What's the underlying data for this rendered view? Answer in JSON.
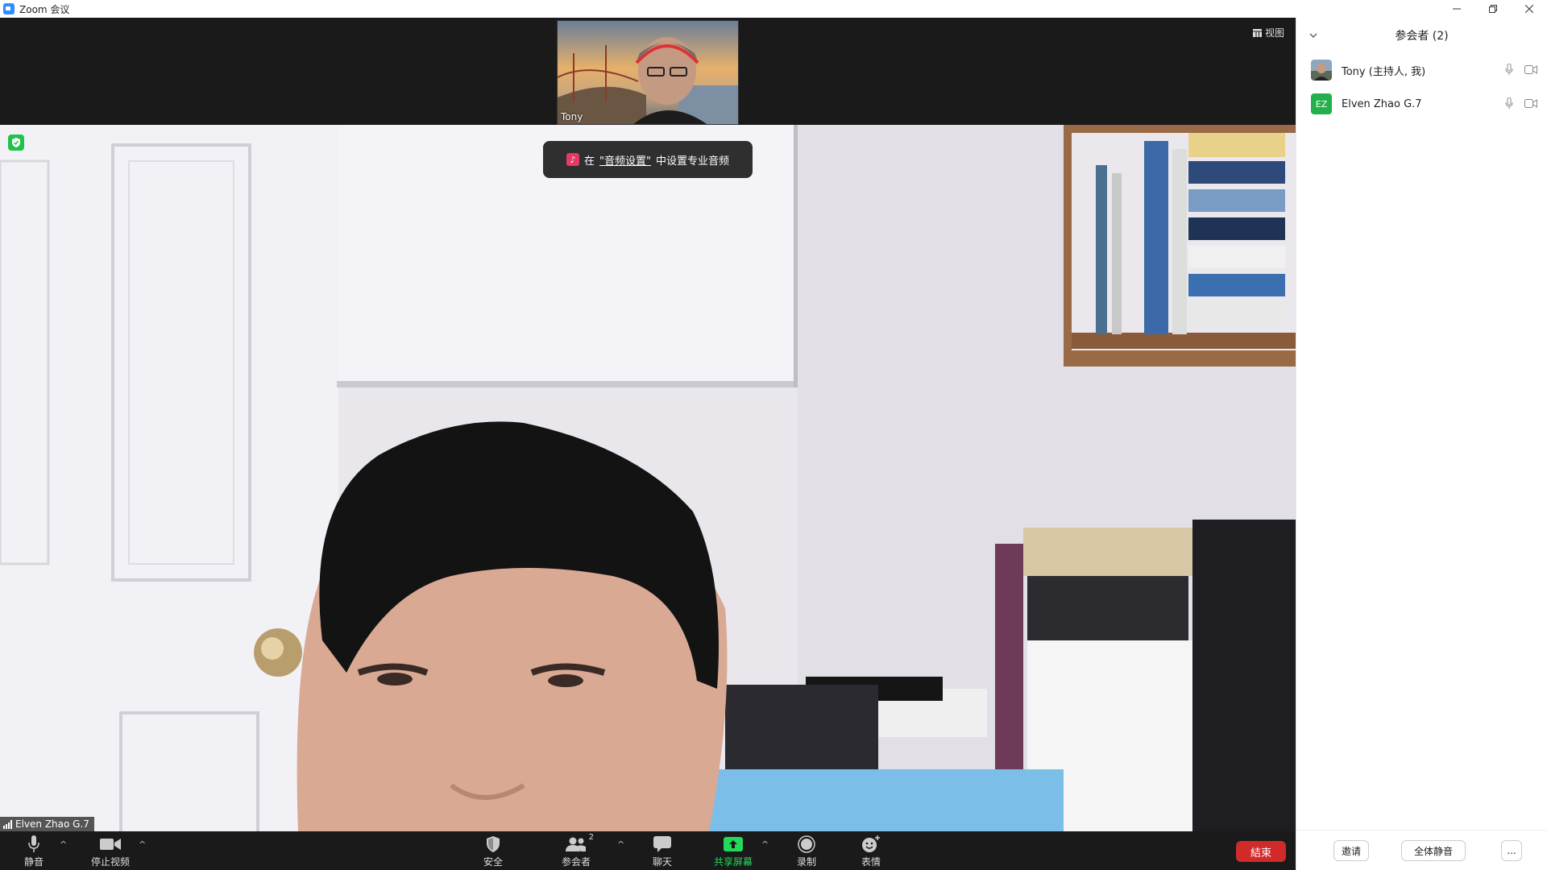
{
  "window": {
    "title": "Zoom 会议"
  },
  "video": {
    "view_label": "视图",
    "thumbnail_name": "Tony",
    "main_speaker_name": "Elven Zhao G.7",
    "toast": {
      "prefix": "在",
      "link": "\"音频设置\"",
      "suffix": "中设置专业音频"
    }
  },
  "toolbar": {
    "mute_label": "静音",
    "stop_video_label": "停止视频",
    "security_label": "安全",
    "participants_label": "参会者",
    "participants_count": "2",
    "chat_label": "聊天",
    "share_label": "共享屏幕",
    "record_label": "录制",
    "reactions_label": "表情",
    "end_label": "結束"
  },
  "panel": {
    "title": "参会者 (2)",
    "participants": [
      {
        "name": "Tony (主持人, 我)",
        "avatar": "photo"
      },
      {
        "name": "Elven Zhao G.7",
        "avatar": "EZ",
        "avatar_color": "#23b04a"
      }
    ],
    "invite_label": "邀请",
    "mute_all_label": "全体静音",
    "more_label": "..."
  },
  "colors": {
    "accent_green": "#23d959",
    "end_red": "#d12a2a",
    "toolbar_bg": "#1a1a1a"
  }
}
